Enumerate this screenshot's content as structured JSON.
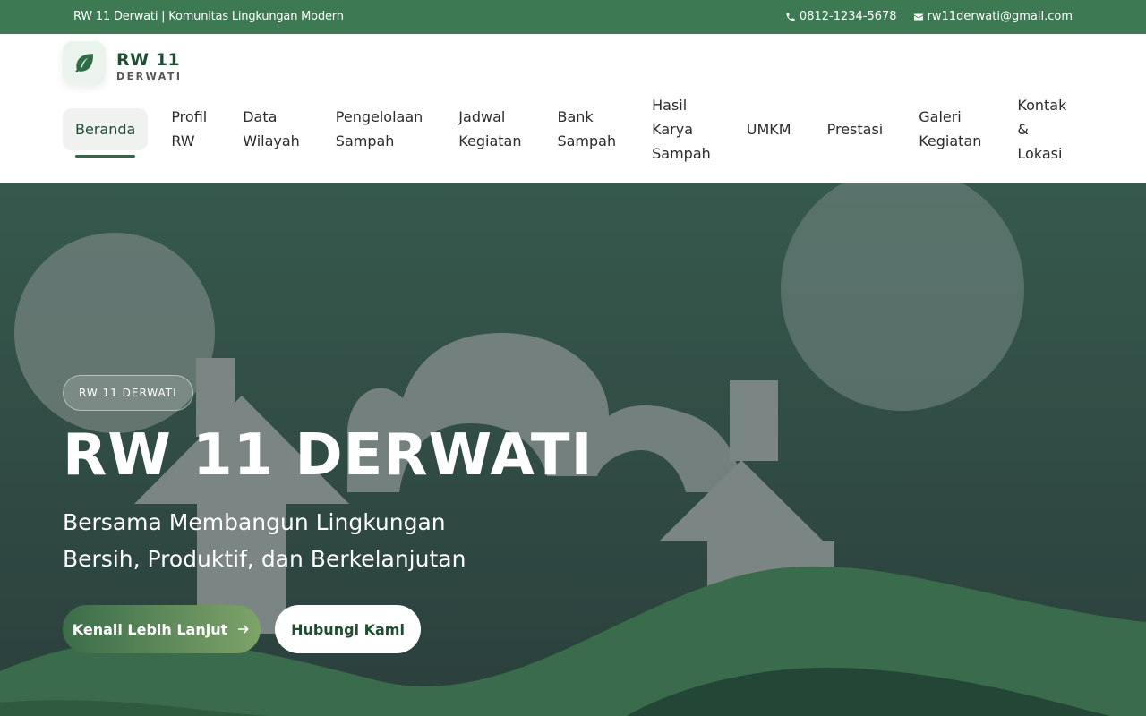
{
  "topbar": {
    "tagline": "RW 11 Derwati | Komunitas Lingkungan Modern",
    "phone": "0812-1234-5678",
    "email": "rw11derwati@gmail.com"
  },
  "logo": {
    "title": "RW 11",
    "subtitle": "DERWATI",
    "icon": "leaf-icon"
  },
  "nav": {
    "items": [
      {
        "line1": "Beranda",
        "line2": "",
        "line3": ""
      },
      {
        "line1": "Profil",
        "line2": "RW",
        "line3": ""
      },
      {
        "line1": "Data",
        "line2": "Wilayah",
        "line3": ""
      },
      {
        "line1": "Pengelolaan",
        "line2": "Sampah",
        "line3": ""
      },
      {
        "line1": "Jadwal",
        "line2": "Kegiatan",
        "line3": ""
      },
      {
        "line1": "Bank",
        "line2": "Sampah",
        "line3": ""
      },
      {
        "line1": "Hasil",
        "line2": "Karya",
        "line3": "Sampah"
      },
      {
        "line1": "UMKM",
        "line2": "",
        "line3": ""
      },
      {
        "line1": "Prestasi",
        "line2": "",
        "line3": ""
      },
      {
        "line1": "Galeri",
        "line2": "Kegiatan",
        "line3": ""
      },
      {
        "line1": "Kontak",
        "line2": "&",
        "line3": "Lokasi"
      }
    ],
    "active": "Beranda"
  },
  "hero": {
    "badge": "RW 11 DERWATI",
    "title": "RW 11 DERWATI",
    "subtitle": "Bersama Membangun Lingkungan Bersih, Produktif, dan Berkelanjutan",
    "primary_button": "Kenali Lebih Lanjut",
    "secondary_button": "Hubungi Kami"
  },
  "colors": {
    "brand": "#3d7a54",
    "accent_dark": "#1f4d33",
    "hero_top": "#36594d",
    "hero_bottom": "#2b3f3c"
  }
}
